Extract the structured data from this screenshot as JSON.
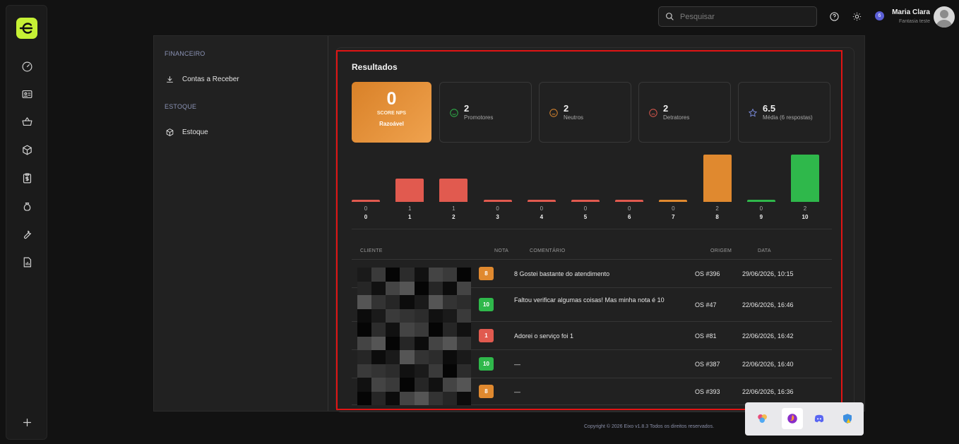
{
  "topbar": {
    "search_placeholder": "Pesquisar",
    "notification_count": "6",
    "user_name": "Maria Clara",
    "user_company": "Fantasia teste"
  },
  "sidebar_sections": [
    {
      "title": "FINANCEIRO",
      "items": [
        {
          "label": "Contas a Receber",
          "icon": "download-icon"
        }
      ]
    },
    {
      "title": "ESTOQUE",
      "items": [
        {
          "label": "Estoque",
          "icon": "box-icon"
        }
      ]
    }
  ],
  "results": {
    "title": "Resultados",
    "score": {
      "value": "0",
      "label": "SCORE NPS",
      "rating": "Razoável"
    },
    "stats": [
      {
        "value": "2",
        "label": "Promotores",
        "icon": "smile-icon",
        "color": "#2fb84b"
      },
      {
        "value": "2",
        "label": "Neutros",
        "icon": "neutral-face-icon",
        "color": "#e0892f"
      },
      {
        "value": "2",
        "label": "Detratores",
        "icon": "frown-icon",
        "color": "#e15a4f"
      },
      {
        "value": "6.5",
        "label": "Média (6 respostas)",
        "icon": "star-icon",
        "color": "#7b8cde"
      }
    ]
  },
  "chart_data": {
    "type": "bar",
    "categories": [
      "0",
      "1",
      "2",
      "3",
      "4",
      "5",
      "6",
      "7",
      "8",
      "9",
      "10"
    ],
    "values": [
      0,
      1,
      1,
      0,
      0,
      0,
      0,
      0,
      2,
      0,
      2
    ],
    "colors": [
      "#e15a4f",
      "#e15a4f",
      "#e15a4f",
      "#e15a4f",
      "#e15a4f",
      "#e15a4f",
      "#e15a4f",
      "#e0892f",
      "#e0892f",
      "#2fb84b",
      "#2fb84b"
    ],
    "ylim": [
      0,
      2
    ]
  },
  "table": {
    "headers": {
      "cliente": "CLIENTE",
      "nota": "NOTA",
      "comentario": "COMENTÁRIO",
      "origem": "ORIGEM",
      "data": "DATA"
    },
    "rows": [
      {
        "nota": "8",
        "nota_color": "#e0892f",
        "comentario": "8 Gostei bastante do atendimento",
        "origem": "OS #396",
        "data": "29/06/2026, 10:15"
      },
      {
        "nota": "10",
        "nota_color": "#2fb84b",
        "comentario": "Faltou verificar algumas coisas! Mas minha nota é 10",
        "origem": "OS #47",
        "data": "22/06/2026, 16:46"
      },
      {
        "nota": "1",
        "nota_color": "#e15a4f",
        "comentario": "Adorei o serviço foi 1",
        "origem": "OS #81",
        "data": "22/06/2026, 16:42"
      },
      {
        "nota": "10",
        "nota_color": "#2fb84b",
        "comentario": "—",
        "origem": "OS #387",
        "data": "22/06/2026, 16:40"
      },
      {
        "nota": "8",
        "nota_color": "#e0892f",
        "comentario": "—",
        "origem": "OS #393",
        "data": "22/06/2026, 16:36"
      }
    ]
  },
  "footer": {
    "copyright": "Copyright © 2026 Eixo v1.8.3 Todos os direitos reservados."
  }
}
